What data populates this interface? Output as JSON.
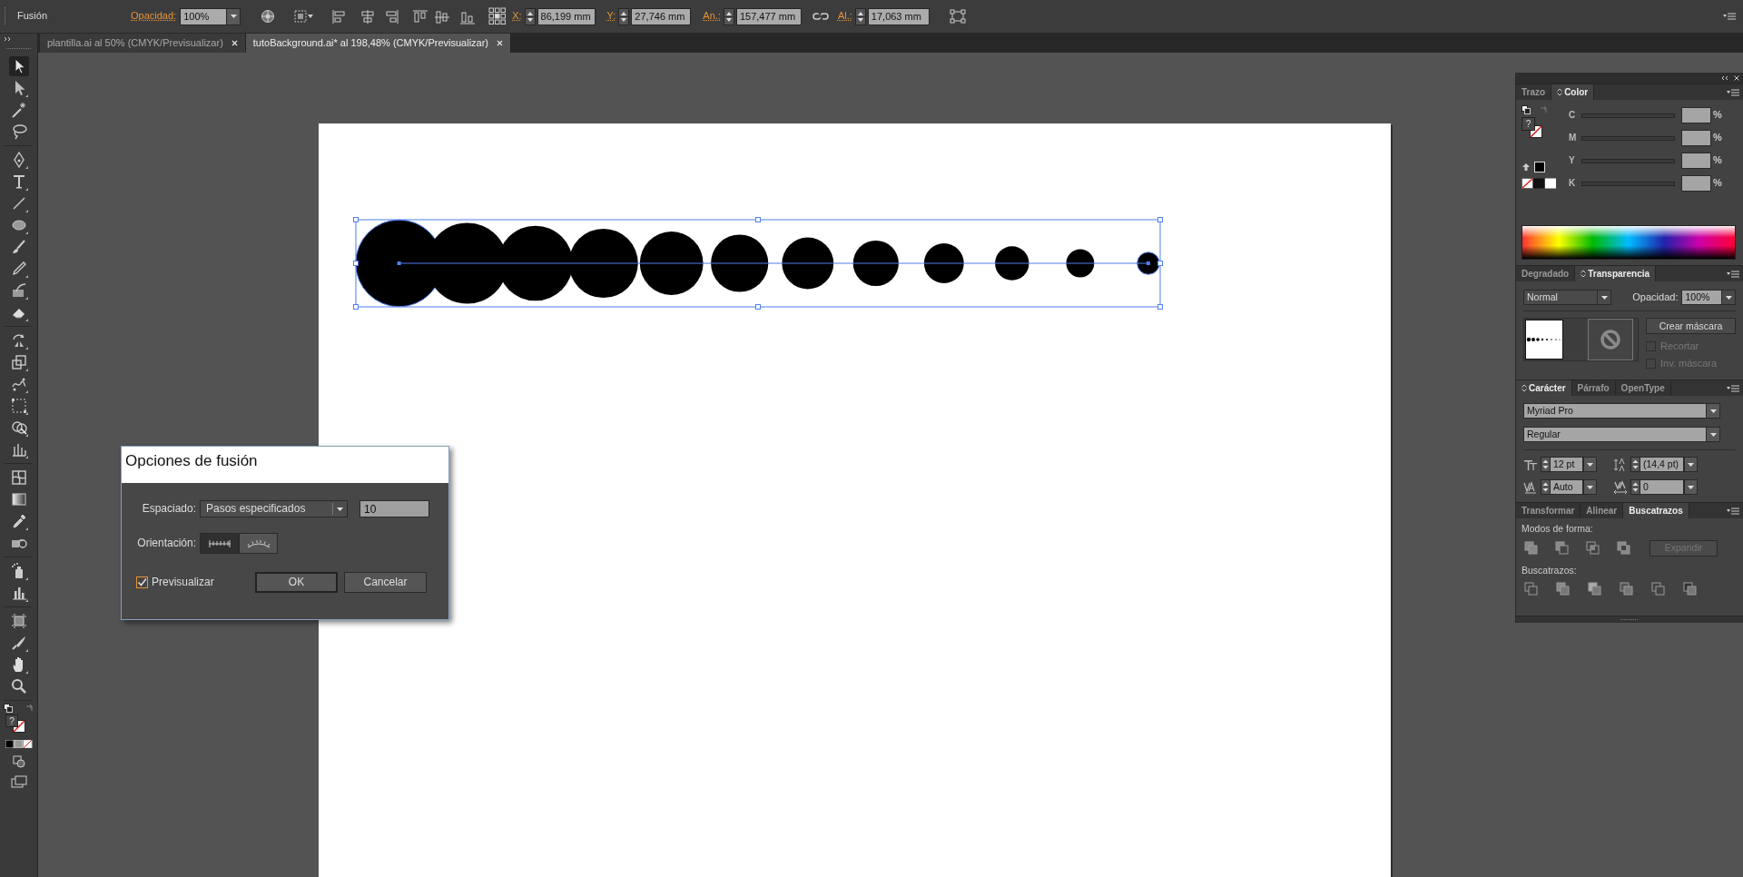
{
  "control_bar": {
    "selection_type": "Fusión",
    "opacity": {
      "label": "Opacidad:",
      "value": "100%"
    },
    "transform_fields": [
      {
        "label": "X:",
        "value": "86,199 mm"
      },
      {
        "label": "Y:",
        "value": "27,746 mm"
      },
      {
        "label": "An.:",
        "value": "157,477 mm"
      },
      {
        "label": "Al.:",
        "value": "17,063 mm"
      }
    ]
  },
  "document_tabs": [
    {
      "label": "plantilla.ai al 50% (CMYK/Previsualizar)",
      "selected": false
    },
    {
      "label": "tutoBackground.ai* al 198,48% (CMYK/Previsualizar)",
      "selected": true
    }
  ],
  "tools": {
    "items": [
      {
        "kind": "selection",
        "selected": true
      },
      {
        "kind": "direct-selection",
        "selected": false
      },
      {
        "kind": "magic-wand",
        "selected": false
      },
      {
        "kind": "lasso",
        "selected": false
      },
      {
        "kind": "pen",
        "selected": false
      },
      {
        "kind": "type",
        "selected": false
      },
      {
        "kind": "line",
        "selected": false
      },
      {
        "kind": "ellipse",
        "selected": false
      },
      {
        "kind": "paintbrush",
        "selected": false
      },
      {
        "kind": "pencil",
        "selected": false
      },
      {
        "kind": "shaper",
        "selected": false
      },
      {
        "kind": "eraser",
        "selected": false
      },
      {
        "kind": "rotate",
        "selected": false
      },
      {
        "kind": "scale",
        "selected": false
      },
      {
        "kind": "warp",
        "selected": false
      },
      {
        "kind": "free-transform",
        "selected": false
      },
      {
        "kind": "shape-builder",
        "selected": false
      },
      {
        "kind": "perspective-grid",
        "selected": false
      },
      {
        "kind": "mesh",
        "selected": false
      },
      {
        "kind": "gradient",
        "selected": false
      },
      {
        "kind": "eyedropper",
        "selected": false
      },
      {
        "kind": "blend",
        "selected": false
      },
      {
        "kind": "symbol-sprayer",
        "selected": false
      },
      {
        "kind": "column-graph",
        "selected": false
      },
      {
        "kind": "artboard",
        "selected": false
      },
      {
        "kind": "knife",
        "selected": false
      },
      {
        "kind": "hand",
        "selected": false
      },
      {
        "kind": "zoom",
        "selected": false
      }
    ],
    "fill_indicator": "?"
  },
  "color_panel": {
    "tabs": [
      {
        "label": "Trazo",
        "selected": false,
        "options_icon": false
      },
      {
        "label": "Color",
        "selected": true,
        "options_icon": true
      }
    ],
    "fill_indicator": "?",
    "channels": [
      {
        "label": "C",
        "unit": "%"
      },
      {
        "label": "M",
        "unit": "%"
      },
      {
        "label": "Y",
        "unit": "%"
      },
      {
        "label": "K",
        "unit": "%"
      }
    ]
  },
  "transparency_panel": {
    "tabs": [
      {
        "label": "Degradado",
        "selected": false,
        "options_icon": false
      },
      {
        "label": "Transparencia",
        "selected": true,
        "options_icon": true
      }
    ],
    "blend_mode": "Normal",
    "opacity_label": "Opacidad:",
    "opacity_value": "100%",
    "mask_button": "Crear máscara",
    "options": [
      {
        "label": "Recortar",
        "checked": false,
        "disabled": true
      },
      {
        "label": "Inv. máscara",
        "checked": false,
        "disabled": true
      }
    ]
  },
  "character_panel": {
    "tabs": [
      {
        "label": "Carácter",
        "selected": true,
        "options_icon": true
      },
      {
        "label": "Párrafo",
        "selected": false,
        "options_icon": false
      },
      {
        "label": "OpenType",
        "selected": false,
        "options_icon": false
      }
    ],
    "font_family": "Myriad Pro",
    "font_style": "Regular",
    "font_size": "12 pt",
    "leading": "(14,4 pt)",
    "kerning": "Auto",
    "tracking": "0"
  },
  "pathfinder_panel": {
    "tabs": [
      {
        "label": "Transformar",
        "selected": false,
        "options_icon": false
      },
      {
        "label": "Alinear",
        "selected": false,
        "options_icon": false
      },
      {
        "label": "Buscatrazos",
        "selected": true,
        "options_icon": false
      }
    ],
    "shape_modes_label": "Modos de forma:",
    "expand_button": {
      "label": "Expandir",
      "disabled": true
    },
    "pathfinders_label": "Buscatrazos:"
  },
  "blend_dialog": {
    "title": "Opciones de fusión",
    "spacing_label": "Espaciado:",
    "spacing_value": "Pasos especificados",
    "steps_value": "10",
    "orientation_label": "Orientación:",
    "orientations": [
      {
        "kind": "page",
        "selected": true
      },
      {
        "kind": "path",
        "selected": false
      }
    ],
    "preview": {
      "label": "Previsualizar",
      "checked": true
    },
    "buttons": [
      {
        "label": "OK",
        "kind": "default"
      },
      {
        "label": "Cancelar",
        "kind": "cancel"
      }
    ]
  }
}
